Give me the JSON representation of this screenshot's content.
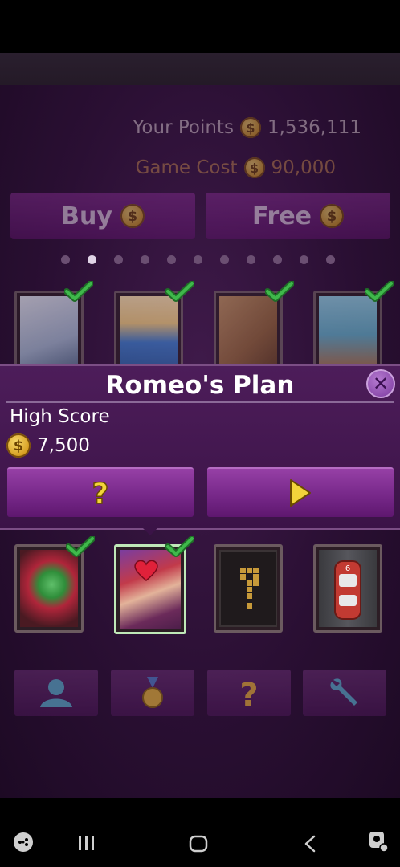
{
  "header": {
    "points_label": "Your Points",
    "points_value": "1,536,111",
    "cost_label": "Game Cost",
    "cost_value": "90,000"
  },
  "buttons": {
    "buy_label": "Buy",
    "free_label": "Free"
  },
  "page_dots": {
    "count": 11,
    "active_index": 1
  },
  "top_cards": [
    {
      "name": "yarn-level-card",
      "completed": true
    },
    {
      "name": "mushroom-level-card",
      "completed": true
    },
    {
      "name": "blocks-level-card",
      "completed": true
    },
    {
      "name": "parachute-level-card",
      "completed": true
    }
  ],
  "panel": {
    "title": "Romeo's Plan",
    "high_score_label": "High Score",
    "high_score_value": "7,500",
    "help_icon": "question-mark-icon",
    "play_icon": "play-icon"
  },
  "bottom_cards": [
    {
      "name": "clown-level-card",
      "completed": true
    },
    {
      "name": "romeos-plan-level-card",
      "completed": true,
      "selected": true
    },
    {
      "name": "locked-level-card",
      "completed": false
    },
    {
      "name": "race-car-level-card",
      "completed": false
    }
  ],
  "bottom_bar": [
    "profile-icon",
    "medal-icon",
    "help-icon",
    "settings-wrench-icon"
  ],
  "coin_symbol": "$",
  "colors": {
    "accent_purple": "#7a2a8c",
    "check_green": "#2e9e3a",
    "coin_gold": "#d49a1c",
    "play_yellow": "#f3d43a"
  }
}
